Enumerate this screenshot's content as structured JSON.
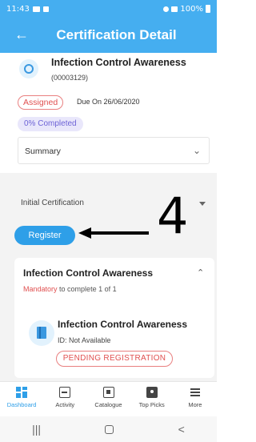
{
  "status_bar": {
    "time": "11:43",
    "battery": "100%"
  },
  "app_bar": {
    "back_icon": "arrow-left-icon",
    "title": "Certification Detail"
  },
  "course": {
    "icon": "award-badge-icon",
    "title": "Infection Control Awareness",
    "code": "(00003129)",
    "status_badge": "Assigned",
    "due_text": "Due On 26/06/2020",
    "progress_text": "0% Completed",
    "summary_label": "Summary"
  },
  "initial_certification": {
    "label": "Initial Certification"
  },
  "register_button": {
    "label": "Register"
  },
  "annotation": {
    "number": "4"
  },
  "session": {
    "title": "Infection Control Awareness",
    "mandatory_label": "Mandatory",
    "requirement_text": "to complete 1 of 1",
    "module": {
      "icon": "book-icon",
      "title": "Infection Control Awareness",
      "id_text": "ID: Not Available",
      "status_badge": "PENDING REGISTRATION"
    }
  },
  "bottom_nav": {
    "items": [
      {
        "label": "Dashboard",
        "icon": "dashboard-icon",
        "active": true
      },
      {
        "label": "Activity",
        "icon": "activity-icon",
        "active": false
      },
      {
        "label": "Catalogue",
        "icon": "catalogue-icon",
        "active": false
      },
      {
        "label": "Top Picks",
        "icon": "top-picks-icon",
        "active": false
      },
      {
        "label": "More",
        "icon": "menu-icon",
        "active": false
      }
    ]
  },
  "system_nav": {
    "recents": "|||",
    "back": "<"
  },
  "colors": {
    "primary": "#45aef0",
    "button": "#2e9fe8",
    "assigned": "#e05050",
    "progress": "#6d63d6",
    "background_band": "#f3f3f3"
  }
}
